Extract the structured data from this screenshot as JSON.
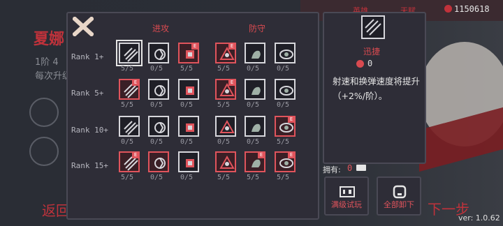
{
  "background": {
    "title": "夏娜",
    "line1": "1阶  4",
    "line2": "每次升级",
    "bottom_left": "返回",
    "bottom_right": "下一步",
    "top_tab1": "英雄",
    "top_tab2": "天赋",
    "coins": "1150618",
    "version": "ver: 1.0.62"
  },
  "panel": {
    "attack_label": "进攻",
    "defense_label": "防守",
    "rows": [
      {
        "rank": "Rank 1+",
        "tiles": [
          {
            "icon": "swift-icon",
            "count": "5/5",
            "style": "white",
            "e": false,
            "sel": true
          },
          {
            "icon": "vortex-icon",
            "count": "0/5",
            "style": "white",
            "e": false
          },
          {
            "icon": "fist-icon",
            "count": "5/5",
            "style": "red",
            "e": true
          },
          {
            "icon": "pentagram-shield-icon",
            "count": "5/5",
            "style": "red",
            "e": true
          },
          {
            "icon": "muscle-icon",
            "count": "0/5",
            "style": "white",
            "e": false
          },
          {
            "icon": "eye-icon",
            "count": "0/5",
            "style": "white",
            "e": false
          }
        ]
      },
      {
        "rank": "Rank 5+",
        "tiles": [
          {
            "icon": "piercing-arrow-icon",
            "count": "5/5",
            "style": "red",
            "e": true
          },
          {
            "icon": "claw-icon",
            "count": "0/5",
            "style": "white",
            "e": false
          },
          {
            "icon": "wind-slash-icon",
            "count": "0/5",
            "style": "white",
            "e": false
          },
          {
            "icon": "guard-fist-icon",
            "count": "5/5",
            "style": "red",
            "e": true
          },
          {
            "icon": "boot-icon",
            "count": "0/5",
            "style": "white",
            "e": false
          },
          {
            "icon": "leaf-icon",
            "count": "0/5",
            "style": "white",
            "e": false
          }
        ]
      },
      {
        "rank": "Rank 10+",
        "tiles": [
          {
            "icon": "grenade-icon",
            "count": "0/5",
            "style": "white",
            "e": false
          },
          {
            "icon": "grab-icon",
            "count": "0/5",
            "style": "white",
            "e": false
          },
          {
            "icon": "burst-icon",
            "count": "0/5",
            "style": "white",
            "e": false
          },
          {
            "icon": "orb-icon",
            "count": "0/5",
            "style": "white",
            "e": false
          },
          {
            "icon": "hearts-icon",
            "count": "0/5",
            "style": "white",
            "e": false
          },
          {
            "icon": "tree-icon",
            "count": "5/5",
            "style": "red",
            "e": true
          }
        ]
      },
      {
        "rank": "Rank 15+",
        "tiles": [
          {
            "icon": "comet-icon",
            "count": "5/5",
            "style": "red",
            "e": true
          },
          {
            "icon": "bloom-icon",
            "count": "0/5",
            "style": "red",
            "e": false
          },
          {
            "icon": "spark-arrows-icon",
            "count": "0/5",
            "style": "white",
            "e": false
          },
          {
            "icon": "cross-heart-icon",
            "count": "5/5",
            "style": "red",
            "e": false
          },
          {
            "icon": "tower-icon",
            "count": "5/5",
            "style": "red",
            "e": true
          },
          {
            "icon": "wave-icon",
            "count": "5/5",
            "style": "red",
            "e": true
          }
        ]
      }
    ]
  },
  "info": {
    "name": "迅捷",
    "cost": "0",
    "description": "射速和换弹速度将提升（+2%/阶）。"
  },
  "owned": {
    "label": "拥有:",
    "value": "0"
  },
  "buttons": {
    "trial": "满级试玩",
    "unequip_all": "全部卸下"
  },
  "colors": {
    "accent": "#e0545c",
    "panel": "#2e2d37",
    "tile_border": "#d7d7dc"
  }
}
